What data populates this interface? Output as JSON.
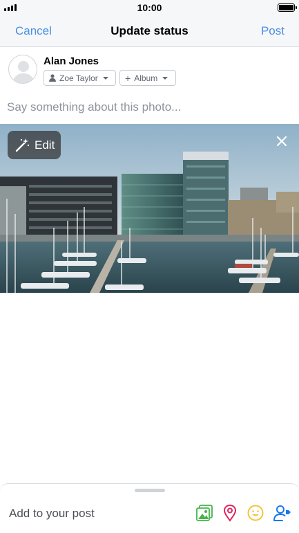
{
  "status_bar": {
    "time": "10:00"
  },
  "nav": {
    "cancel_label": "Cancel",
    "title": "Update status",
    "post_label": "Post"
  },
  "composer": {
    "author": "Alan Jones",
    "audience_label": "Zoe Taylor",
    "album_label": "Album",
    "placeholder": "Say something about this photo..."
  },
  "photo": {
    "edit_label": "Edit"
  },
  "sheet": {
    "add_label": "Add to your post"
  },
  "colors": {
    "accent_blue": "#4a90e2",
    "photo_green": "#44b549",
    "location_pink": "#e0245e",
    "feeling_yellow": "#f5c33b",
    "tag_blue": "#1877f2"
  },
  "icons": [
    "signal-icon",
    "battery-icon",
    "avatar-placeholder-icon",
    "person-icon",
    "plus-icon",
    "magic-wand-icon",
    "close-icon",
    "photo-icon",
    "location-pin-icon",
    "smiley-icon",
    "tag-people-icon"
  ]
}
